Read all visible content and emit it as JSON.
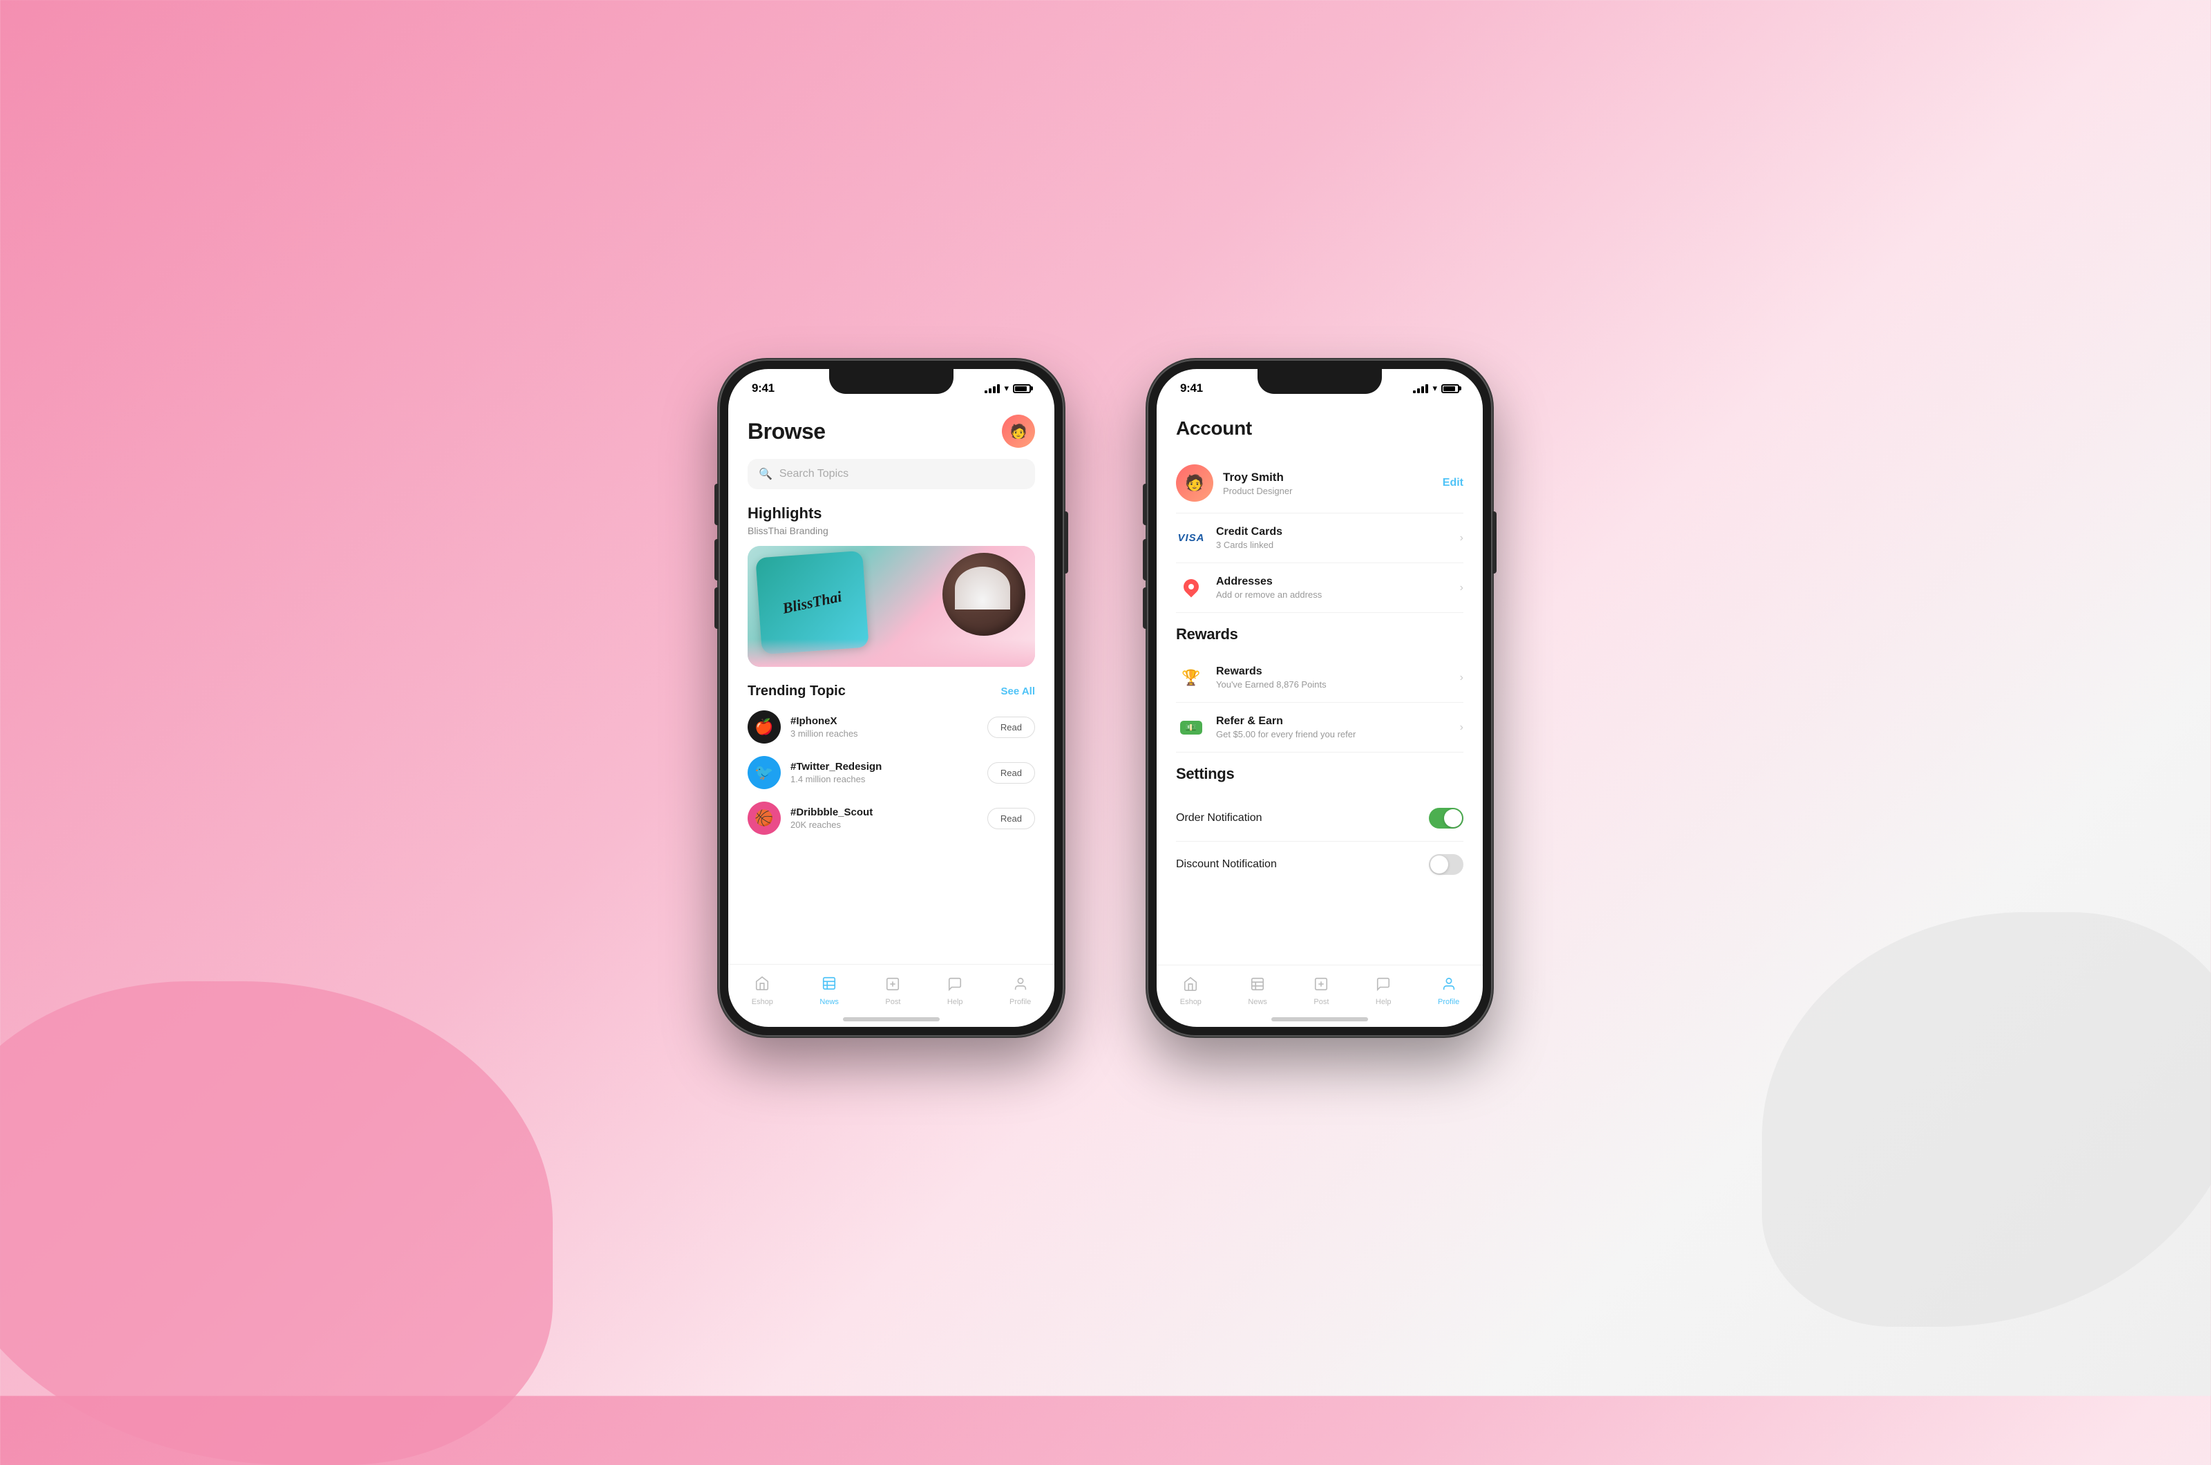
{
  "background": {
    "color_left": "#f48fb1",
    "color_right": "#eeeeee"
  },
  "phone_browse": {
    "status": {
      "time": "9:41",
      "signal": "full",
      "wifi": true,
      "battery": 85
    },
    "header": {
      "title": "Browse",
      "avatar_emoji": "👤"
    },
    "search": {
      "placeholder": "Search Topics"
    },
    "highlights": {
      "section_label": "Highlights",
      "subtitle": "BlissThai Branding",
      "card_text": "BlissThai"
    },
    "trending": {
      "section_label": "Trending Topic",
      "see_all": "See All",
      "items": [
        {
          "name": "#IphoneX",
          "reach": "3 million reaches",
          "icon": "🍎",
          "bg": "apple"
        },
        {
          "name": "#Twitter_Redesign",
          "reach": "1.4 million reaches",
          "icon": "🐦",
          "bg": "twitter"
        },
        {
          "name": "#Dribbble_Scout",
          "reach": "20K reaches",
          "icon": "🏀",
          "bg": "dribbble"
        }
      ],
      "read_label": "Read"
    },
    "bottom_nav": {
      "items": [
        {
          "label": "Eshop",
          "icon": "⊞",
          "active": false
        },
        {
          "label": "News",
          "icon": "▦",
          "active": true
        },
        {
          "label": "Post",
          "icon": "⊡",
          "active": false
        },
        {
          "label": "Help",
          "icon": "💬",
          "active": false
        },
        {
          "label": "Profile",
          "icon": "👤",
          "active": false
        }
      ]
    }
  },
  "phone_account": {
    "status": {
      "time": "9:41",
      "signal": "full",
      "wifi": true,
      "battery": 85
    },
    "header": {
      "title": "Account"
    },
    "profile": {
      "name": "Troy Smith",
      "role": "Product Designer",
      "edit_label": "Edit",
      "avatar_emoji": "😊"
    },
    "menu": {
      "credit_cards": {
        "label": "Credit Cards",
        "sub": "3 Cards linked",
        "icon_text": "VISA"
      },
      "addresses": {
        "label": "Addresses",
        "sub": "Add or remove an address"
      }
    },
    "rewards_section": {
      "heading": "Rewards",
      "rewards_item": {
        "label": "Rewards",
        "sub": "You've Earned 8,876 Points",
        "icon": "🏆"
      },
      "refer_item": {
        "label": "Refer & Earn",
        "sub": "Get $5.00 for every friend you refer",
        "icon": "💵"
      }
    },
    "settings_section": {
      "heading": "Settings",
      "order_notification": {
        "label": "Order Notification",
        "enabled": true
      },
      "discount_notification": {
        "label": "Discount Notification",
        "enabled": false
      }
    },
    "bottom_nav": {
      "items": [
        {
          "label": "Eshop",
          "icon": "⊞",
          "active": false
        },
        {
          "label": "News",
          "icon": "▦",
          "active": false
        },
        {
          "label": "Post",
          "icon": "⊡",
          "active": false
        },
        {
          "label": "Help",
          "icon": "💬",
          "active": false
        },
        {
          "label": "Profile",
          "icon": "👤",
          "active": true
        }
      ]
    }
  }
}
